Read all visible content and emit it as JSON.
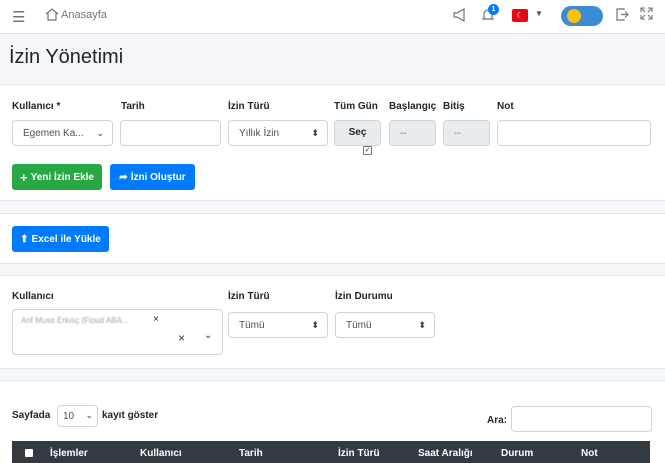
{
  "topbar": {
    "breadcrumb": "Anasayfa",
    "notification_count": "1"
  },
  "page": {
    "title": "İzin Yönetimi"
  },
  "form": {
    "user_label": "Kullanıcı *",
    "user_value": "Egemen Ka...",
    "date_label": "Tarih",
    "date_value": "",
    "type_label": "İzin Türü",
    "type_value": "Yıllık İzin",
    "allday_label": "Tüm Gün",
    "allday_button": "Seç",
    "start_label": "Başlangıç",
    "start_value": "--",
    "end_label": "Bitiş",
    "end_value": "--",
    "note_label": "Not",
    "note_value": "",
    "add_button": "Yeni İzin Ekle",
    "create_button": "İzni Oluştur"
  },
  "excel": {
    "upload_button": "Excel ile Yükle"
  },
  "filter": {
    "user_label": "Kullanıcı",
    "selected_user": "Arif Musa Erkılıç (Floud ABA...",
    "type_label": "İzin Türü",
    "type_value": "Tümü",
    "status_label": "İzin Durumu",
    "status_value": "Tümü"
  },
  "table": {
    "page_label": "Sayfada",
    "page_size": "10",
    "page_suffix": "kayıt göster",
    "search_label": "Ara:",
    "columns": [
      "İşlemler",
      "Kullanıcı",
      "Tarih",
      "İzin Türü",
      "Saat Aralığı",
      "Durum",
      "Not"
    ]
  },
  "colors": {
    "green": "#28a745",
    "blue": "#007bff",
    "header": "#343a40"
  }
}
